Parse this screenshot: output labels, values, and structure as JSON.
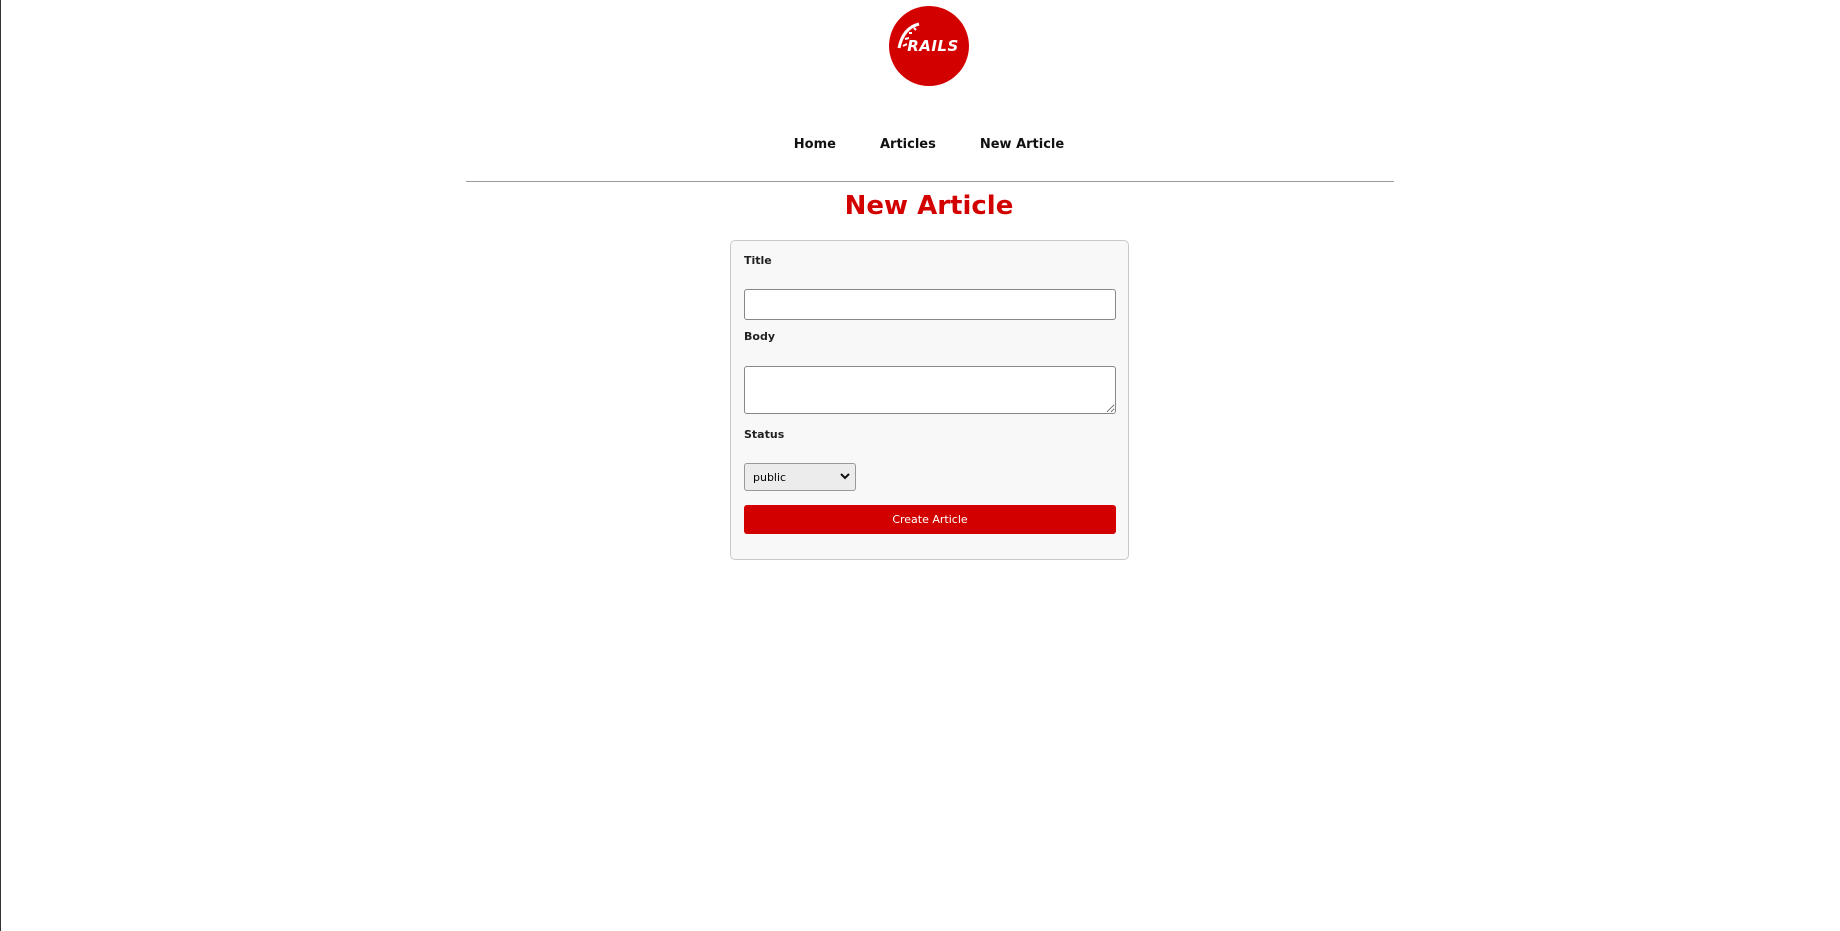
{
  "logo": {
    "text": "RAILS",
    "color": "#d30000"
  },
  "nav": {
    "items": [
      {
        "label": "Home"
      },
      {
        "label": "Articles"
      },
      {
        "label": "New Article"
      }
    ]
  },
  "page": {
    "title": "New Article"
  },
  "form": {
    "title_label": "Title",
    "title_value": "",
    "body_label": "Body",
    "body_value": "",
    "status_label": "Status",
    "status_value": "public",
    "submit_label": "Create Article"
  },
  "colors": {
    "accent": "#d30000",
    "card_bg": "#f8f8f8"
  },
  "icons": {
    "select_caret": "chevron-down-icon"
  }
}
